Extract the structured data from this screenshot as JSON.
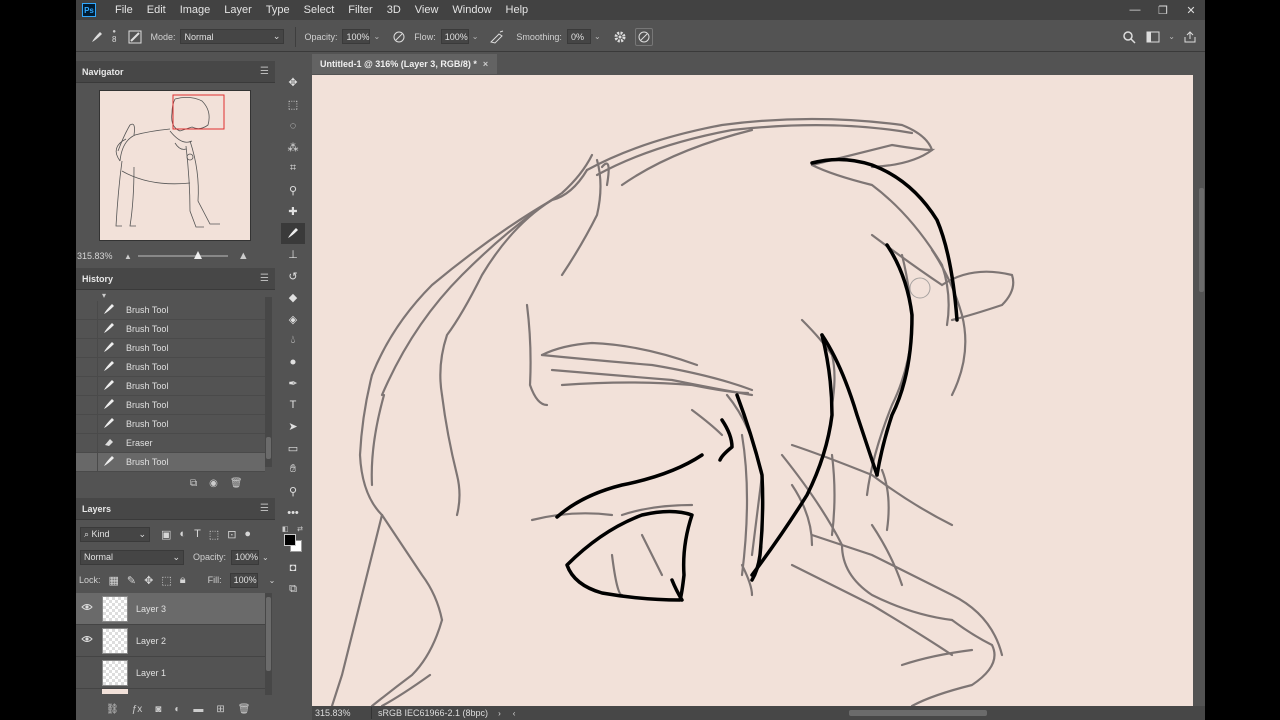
{
  "app": {
    "logo": "Ps"
  },
  "menu": [
    "File",
    "Edit",
    "Image",
    "Layer",
    "Type",
    "Select",
    "Filter",
    "3D",
    "View",
    "Window",
    "Help"
  ],
  "window_controls": {
    "minimize": "—",
    "restore": "❐",
    "close": "✕"
  },
  "options": {
    "brush_size": "8",
    "mode_label": "Mode:",
    "mode_value": "Normal",
    "opacity_label": "Opacity:",
    "opacity_value": "100%",
    "flow_label": "Flow:",
    "flow_value": "100%",
    "smoothing_label": "Smoothing:",
    "smoothing_value": "0%"
  },
  "navigator": {
    "title": "Navigator",
    "zoom": "315.83%"
  },
  "history": {
    "title": "History",
    "items": [
      {
        "label": "Brush Tool",
        "icon": "brush-icon"
      },
      {
        "label": "Brush Tool",
        "icon": "brush-icon"
      },
      {
        "label": "Brush Tool",
        "icon": "brush-icon"
      },
      {
        "label": "Brush Tool",
        "icon": "brush-icon"
      },
      {
        "label": "Brush Tool",
        "icon": "brush-icon"
      },
      {
        "label": "Brush Tool",
        "icon": "brush-icon"
      },
      {
        "label": "Brush Tool",
        "icon": "brush-icon"
      },
      {
        "label": "Eraser",
        "icon": "eraser-icon"
      },
      {
        "label": "Brush Tool",
        "icon": "brush-icon"
      }
    ]
  },
  "layers": {
    "title": "Layers",
    "filter_label": "Kind",
    "blend_mode": "Normal",
    "opacity_label": "Opacity:",
    "opacity_value": "100%",
    "lock_label": "Lock:",
    "fill_label": "Fill:",
    "fill_value": "100%",
    "items": [
      {
        "name": "Layer 3",
        "visible": true,
        "active": true
      },
      {
        "name": "Layer 2",
        "visible": true,
        "active": false
      },
      {
        "name": "Layer 1",
        "visible": false,
        "active": false
      }
    ]
  },
  "document": {
    "tab_title": "Untitled-1 @ 316% (Layer 3, RGB/8) *",
    "tab_close": "×",
    "canvas_color": "#f2e1d9"
  },
  "status": {
    "zoom": "315.83%",
    "profile": "sRGB IEC61966-2.1 (8bpc)"
  },
  "colors": {
    "foreground": "#000000",
    "background": "#ffffff",
    "accent": "#31a8ff"
  }
}
